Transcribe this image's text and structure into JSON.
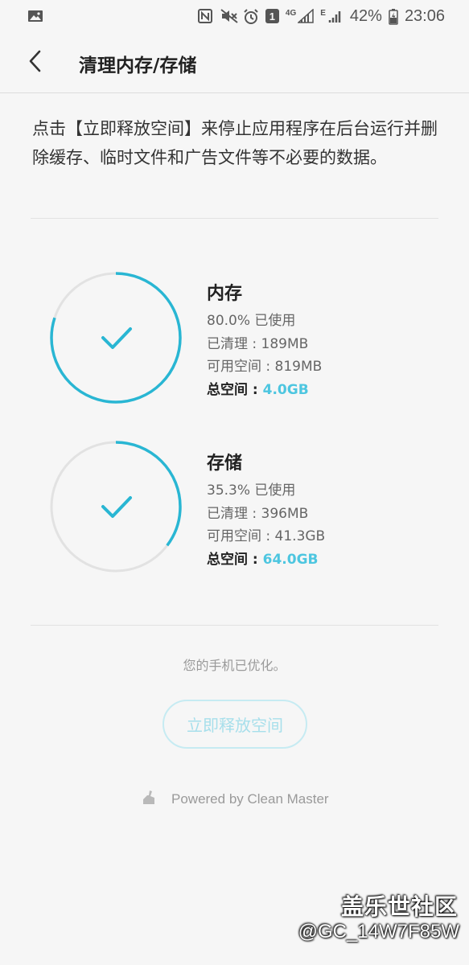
{
  "status_bar": {
    "battery_percent": "42%",
    "time": "23:06",
    "network_4g": "4G",
    "network_e": "E",
    "notification_count": "1",
    "left_icon": "image-icon",
    "right_icons": [
      "nfc-icon",
      "mute-icon",
      "alarm-icon",
      "notification-badge",
      "signal-icon",
      "signal-icon",
      "battery-icon"
    ]
  },
  "app_bar": {
    "title": "清理内存/存储",
    "back_icon": "chevron-left-icon"
  },
  "description": "点击【立即释放空间】来停止应用程序在后台运行并删除缓存、临时文件和广告文件等不必要的数据。",
  "memory": {
    "title": "内存",
    "used": "80.0% 已使用",
    "cleaned": "已清理 : 189MB",
    "available": "可用空间 : 819MB",
    "total_label": "总空间 : ",
    "total_value": "4.0GB",
    "progress": 0.8
  },
  "storage": {
    "title": "存储",
    "used": "35.3% 已使用",
    "cleaned": "已清理 : 396MB",
    "available": "可用空间 : 41.3GB",
    "total_label": "总空间 : ",
    "total_value": "64.0GB",
    "progress": 0.353
  },
  "optimized_text": "您的手机已优化。",
  "free_button_label": "立即释放空间",
  "powered_by": "Powered by Clean Master",
  "watermark": {
    "title": "盖乐世社区",
    "user": "@GC_14W7F85W"
  },
  "colors": {
    "accent": "#29b6d3",
    "ring_track": "#e2e2e2",
    "total_value": "#4dc6e0"
  }
}
